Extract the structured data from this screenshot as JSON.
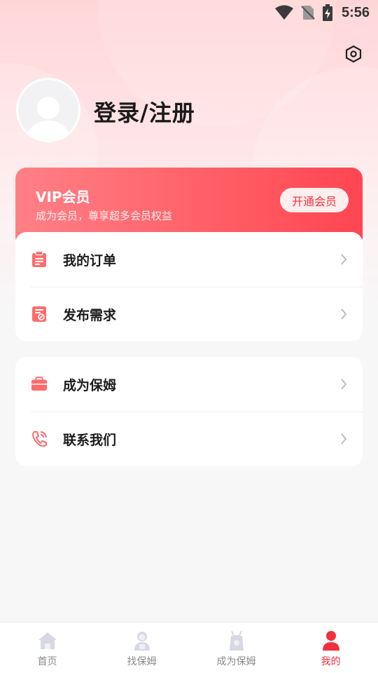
{
  "status_bar": {
    "time": "5:56"
  },
  "profile": {
    "login_label": "登录/注册"
  },
  "vip": {
    "title": "VIP会员",
    "subtitle": "成为会员，尊享超多会员权益",
    "button_label": "开通会员"
  },
  "menu_group_1": [
    {
      "label": "我的订单",
      "icon": "clipboard-icon"
    },
    {
      "label": "发布需求",
      "icon": "edit-form-icon"
    }
  ],
  "menu_group_2": [
    {
      "label": "成为保姆",
      "icon": "briefcase-icon"
    },
    {
      "label": "联系我们",
      "icon": "phone-icon"
    }
  ],
  "bottom_nav": [
    {
      "label": "首页",
      "icon": "home-icon",
      "active": false
    },
    {
      "label": "找保姆",
      "icon": "nanny-icon",
      "active": false
    },
    {
      "label": "成为保姆",
      "icon": "apron-icon",
      "active": false
    },
    {
      "label": "我的",
      "icon": "user-icon",
      "active": true
    }
  ],
  "colors": {
    "accent": "#f0303a",
    "menu_icon": "#ff6b6b",
    "vip_gradient_start": "#ff8086",
    "vip_gradient_end": "#ff4552",
    "nav_inactive": "#8a8a8a"
  }
}
